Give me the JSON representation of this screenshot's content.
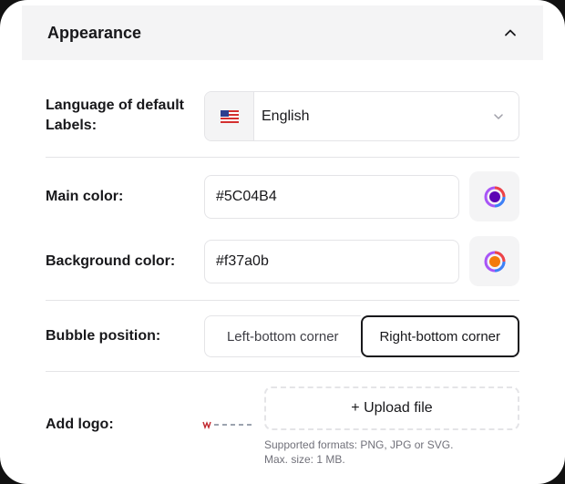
{
  "section": {
    "title": "Appearance"
  },
  "language": {
    "label": "Language of default Labels:",
    "flag_icon": "us-flag-icon",
    "value": "English"
  },
  "main_color": {
    "label": "Main color:",
    "value": "#5C04B4"
  },
  "background_color": {
    "label": "Background color:",
    "value": "#f37a0b"
  },
  "bubble_position": {
    "label": "Bubble position:",
    "options": [
      "Left-bottom corner",
      "Right-bottom corner"
    ],
    "selected": "Right-bottom corner"
  },
  "logo": {
    "label": "Add logo:",
    "upload_label": "+ Upload file",
    "hint_formats": "Supported formats: PNG, JPG or SVG.",
    "hint_size": "Max. size: 1 MB."
  },
  "colors": {
    "accent": "#18181b",
    "border": "#e4e4e7",
    "muted_bg": "#f4f4f5"
  }
}
